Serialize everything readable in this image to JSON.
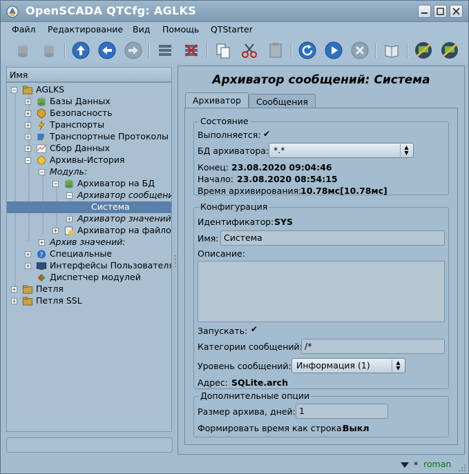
{
  "window": {
    "title": "OpenSCADA QTCfg: AGLKS"
  },
  "menu": [
    "Файл",
    "Редактирование",
    "Вид",
    "Помощь",
    "QTStarter"
  ],
  "toolbar": {
    "icons": [
      "db-load-icon",
      "db-save-icon",
      "up-icon",
      "back-icon",
      "forward-icon",
      "add-item-icon",
      "delete-item-icon",
      "copy-icon",
      "cut-icon",
      "paste-icon",
      "refresh-icon",
      "start-icon",
      "stop-icon",
      "manual-icon",
      "remote-station-icon",
      "remote-station-2-icon"
    ]
  },
  "tree": {
    "header": "Имя",
    "items": [
      {
        "label": "AGLKS",
        "italic": false,
        "selected": false
      },
      {
        "label": "Базы Данных",
        "italic": false,
        "selected": false
      },
      {
        "label": "Безопасность",
        "italic": false,
        "selected": false
      },
      {
        "label": "Транспорты",
        "italic": false,
        "selected": false
      },
      {
        "label": "Транспортные Протоколы",
        "italic": false,
        "selected": false
      },
      {
        "label": "Сбор Данных",
        "italic": false,
        "selected": false
      },
      {
        "label": "Архивы-История",
        "italic": false,
        "selected": false
      },
      {
        "label": "Модуль:",
        "italic": true,
        "selected": false
      },
      {
        "label": "Архиватор на БД",
        "italic": false,
        "selected": false
      },
      {
        "label": "Архиватор сообщений:",
        "italic": true,
        "selected": false
      },
      {
        "label": "Система",
        "italic": false,
        "selected": true
      },
      {
        "label": "Архиватор значений:",
        "italic": true,
        "selected": false
      },
      {
        "label": "Архиватор на файловой",
        "italic": false,
        "selected": false
      },
      {
        "label": "Архив значений:",
        "italic": true,
        "selected": false
      },
      {
        "label": "Специальные",
        "italic": false,
        "selected": false
      },
      {
        "label": "Интерфейсы Пользователя",
        "italic": false,
        "selected": false
      },
      {
        "label": "Диспетчер модулей",
        "italic": false,
        "selected": false
      },
      {
        "label": "Петля",
        "italic": false,
        "selected": false
      },
      {
        "label": "Петля SSL",
        "italic": false,
        "selected": false
      }
    ]
  },
  "page": {
    "title": "Архиватор сообщений: Система",
    "tabs": [
      "Архиватор",
      "Сообщения"
    ],
    "state": {
      "group_title": "Состояние",
      "running_label": "Выполняется:",
      "running_checked": true,
      "db_label": "БД архиватора:",
      "db_value": "*.*",
      "end_label": "Конец:",
      "end_value": "23.08.2020 09:04:46",
      "begin_label": "Начало:",
      "begin_value": "23.08.2020 08:54:15",
      "archtime_label": "Время архивирования:",
      "archtime_value": "10.78мс[10.78мс]"
    },
    "config": {
      "group_title": "Конфигурация",
      "id_label": "Идентификатор:",
      "id_value": "SYS",
      "name_label": "Имя:",
      "name_value": "Система",
      "descr_label": "Описание:",
      "descr_value": "",
      "start_label": "Запускать:",
      "start_checked": true,
      "categories_label": "Категории сообщений:",
      "categories_value": "/*",
      "level_label": "Уровень сообщений:",
      "level_value": "Информация (1)",
      "address_label": "Адрес:",
      "address_value": "SQLite.arch"
    },
    "extra": {
      "group_title": "Дополнительные опции",
      "size_label": "Размер архива, дней:",
      "size_value": "1",
      "timestr_label": "Формировать время как строка:",
      "timestr_value": "Выкл"
    }
  },
  "status": {
    "user_marker": "*",
    "user": "roman"
  }
}
